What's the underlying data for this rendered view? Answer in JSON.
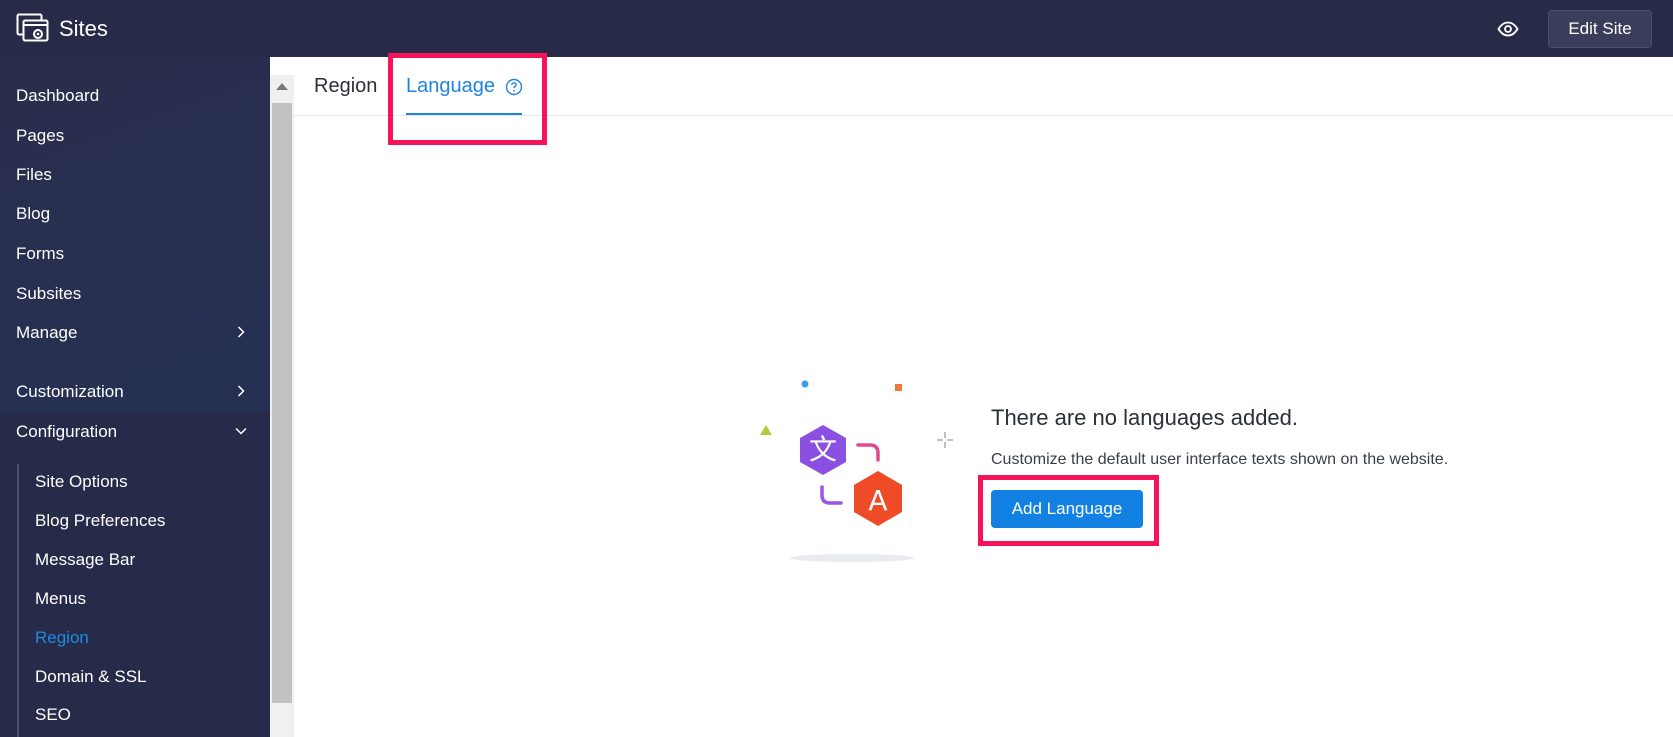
{
  "app": {
    "title": "Sites",
    "edit_label": "Edit Site",
    "preview_icon": "eye-icon"
  },
  "sidebar": {
    "items": [
      {
        "label": "Dashboard"
      },
      {
        "label": "Pages"
      },
      {
        "label": "Files"
      },
      {
        "label": "Blog"
      },
      {
        "label": "Forms"
      },
      {
        "label": "Subsites"
      },
      {
        "label": "Manage"
      },
      {
        "label": "Customization"
      },
      {
        "label": "Configuration"
      }
    ],
    "sub_items": [
      {
        "label": "Site Options"
      },
      {
        "label": "Blog Preferences"
      },
      {
        "label": "Message Bar"
      },
      {
        "label": "Menus"
      },
      {
        "label": "Region",
        "active": true
      },
      {
        "label": "Domain & SSL"
      },
      {
        "label": "SEO"
      }
    ]
  },
  "tabs": {
    "region": "Region",
    "language": "Language",
    "active": "Language"
  },
  "empty_state": {
    "title": "There are no languages added.",
    "description": "Customize the default user interface texts shown on the website.",
    "button": "Add Language",
    "glyph_a": "文",
    "glyph_b": "A"
  },
  "colors": {
    "topbar": "#272b47",
    "accent": "#1f84e0",
    "highlight": "#f5135a",
    "button": "#1380e3"
  }
}
